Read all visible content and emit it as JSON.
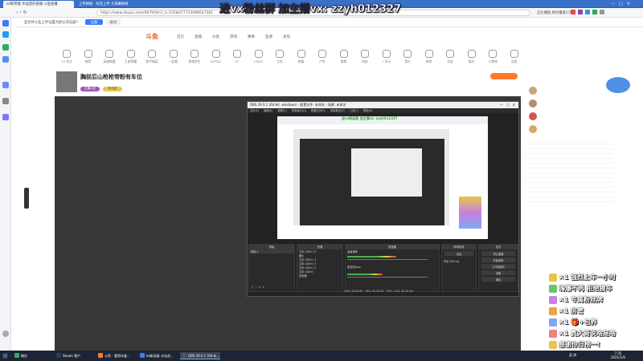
{
  "browser": {
    "tabs": [
      {
        "label": "lol新英雄 水仙花的直播 斗鱼直播",
        "active": true
      },
      {
        "label": "上传网络 - 抖音上传 大屏幕网络",
        "active": false
      }
    ],
    "url": "https://www.douyu.com/4679/0m?_t=535&677723096627361",
    "security_label": "",
    "right_text": "正在播放 网页播放170%"
  },
  "notice": {
    "text": "是否将斗鱼上传设置为默认浏览器?",
    "confirm": "设置",
    "cancel": "取消"
  },
  "overlay_text": "进vx粉丝群 加主播vx: zzyh012327",
  "site": {
    "logo": "斗鱼",
    "nav": [
      "首页",
      "直播",
      "分类",
      "游戏",
      "赛事",
      "鱼塘",
      "发现"
    ],
    "categories": [
      "12 关注",
      "推荐",
      "英雄联盟",
      "王者荣耀",
      "和平精英",
      "一起看",
      "绝地求生",
      "DOTA2",
      "CF",
      "CSGO",
      "主机",
      "颜值",
      "户外",
      "美食",
      "科技",
      "二次元",
      "音乐",
      "体育",
      "交友",
      "娱乐",
      "小游戏",
      "全部"
    ],
    "room": {
      "title": "胸前后山枪枪带粉有车位",
      "badges": [
        "主播认证",
        "粉丝团"
      ]
    }
  },
  "obs": {
    "title": "OBS 29.0.1 (64-bit, windows) - 配置文件: 未命名 - 场景: 未命名",
    "menu": [
      "文件(F)",
      "编辑(E)",
      "视图(V)",
      "停靠窗口(D)",
      "配置文件(P)",
      "场景集合(S)",
      "工具(T)",
      "帮助(H)"
    ],
    "docks": {
      "scenes": {
        "title": "场景",
        "items": [
          "场景 2"
        ]
      },
      "sources": {
        "title": "来源",
        "items": [
          "文本 (GDI+) 5",
          "图片",
          "文本 (GDI+) 4",
          "文本 (GDI+) 3",
          "文本 (GDI+) 2",
          "文本 (GDI+)",
          "浏览器"
        ]
      },
      "mixer": {
        "title": "混音器",
        "items": [
          "桌面音频",
          "麦克风/Aux"
        ],
        "levels": [
          0.55,
          0.4
        ]
      },
      "transitions": {
        "title": "转场特效",
        "value": "淡出",
        "duration_label": "时长",
        "duration": "300 ms"
      },
      "controls": {
        "title": "控件",
        "buttons": [
          "停止直播",
          "开始录制",
          "工作室模式",
          "设置",
          "退出"
        ]
      }
    },
    "status": {
      "live": "LIVE: 00:00:00",
      "rec": "REC: 00:00:00",
      "cpu": "CPU: 1.4%, 60.00 fps"
    }
  },
  "gifts": [
    {
      "text": "×1 强烈上车一小时",
      "color": "#e8c646"
    },
    {
      "text": "嗨爆不再 拒绝摸车",
      "color": "#6cc36c"
    },
    {
      "text": "×1 专属粉丝牌",
      "color": "#c97fe0"
    },
    {
      "text": "×1 房管",
      "color": "#eea24b"
    },
    {
      "text": "×1 🎁+包养",
      "color": "#7fa8f0"
    },
    {
      "text": "×1 真大哥说啥是啥",
      "color": "#f07f7f"
    },
    {
      "text": "感谢你日榜一!",
      "color": "#f0c050"
    }
  ],
  "taskbar": {
    "items": [
      {
        "label": "微信",
        "color": "#2aae67",
        "active": false
      },
      {
        "label": "Steam 客户",
        "color": "#2a3f5f",
        "active": false
      },
      {
        "label": "斗鱼 - 看到年鉴...",
        "color": "#ff7a2b",
        "active": false
      },
      {
        "label": "lol新英雄 水仙花...",
        "color": "#3b7cf5",
        "active": false
      },
      {
        "label": "OBS 29.0.1 (64-bi...",
        "color": "#555",
        "active": true
      }
    ],
    "tray_text": "英 拼",
    "time": "7:35",
    "date": "2021/1/6"
  }
}
